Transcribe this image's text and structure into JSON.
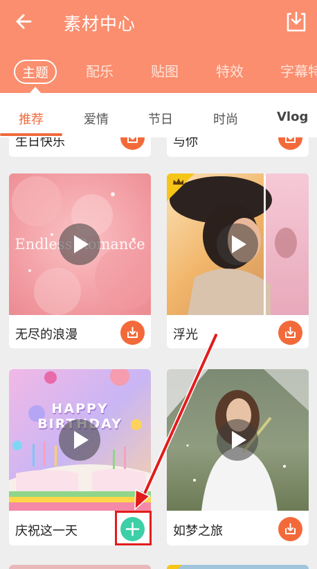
{
  "header": {
    "title": "素材中心",
    "back_icon": "arrow-left-icon",
    "download_icon": "download-tray-icon"
  },
  "category_tabs": [
    "主题",
    "配乐",
    "贴图",
    "特效",
    "字幕特"
  ],
  "sub_tabs": [
    "推荐",
    "爱情",
    "节日",
    "时尚",
    "Vlog"
  ],
  "partial_row": [
    {
      "title": "生日快乐"
    },
    {
      "title": "与你"
    }
  ],
  "cards": [
    {
      "title": "无尽的浪漫",
      "overlay_text": "Endless Romance",
      "action": "download"
    },
    {
      "title": "浮光",
      "action": "download",
      "premium": true
    },
    {
      "title": "庆祝这一天",
      "overlay_text": "HAPPY BIRTHDAY",
      "action": "add"
    },
    {
      "title": "如梦之旅",
      "action": "download"
    }
  ],
  "colors": {
    "brand": "#fa8e6e",
    "accent": "#f06b3c",
    "add": "#3ccfa8",
    "highlight": "#e21c1c"
  }
}
